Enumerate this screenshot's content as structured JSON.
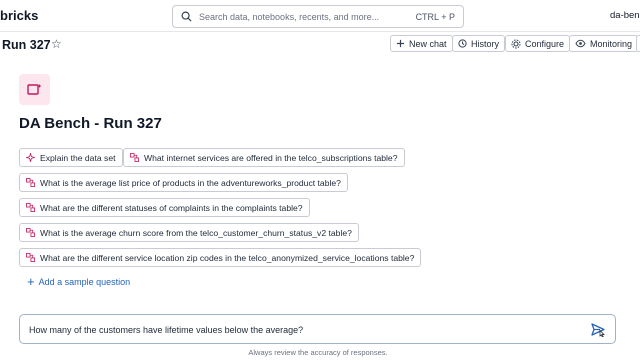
{
  "brand": "bricks",
  "search": {
    "placeholder": "Search data, notebooks, recents, and more...",
    "shortcut": "CTRL + P"
  },
  "workspace": "da-benc",
  "page": {
    "title": "Run 327"
  },
  "toolbar": {
    "new_chat": "New chat",
    "history": "History",
    "configure": "Configure",
    "monitoring": "Monitoring"
  },
  "space": {
    "title": "DA Bench - Run 327"
  },
  "suggestions": [
    "Explain the data set",
    "What internet services are offered in the telco_subscriptions table?",
    "What is the average list price of products in the adventureworks_product table?",
    "What are the different statuses of complaints in the complaints table?",
    "What is the average churn score from the telco_customer_churn_status_v2 table?",
    "What are the different service location zip codes in the telco_anonymized_service_locations table?"
  ],
  "add_sample_label": "Add a sample question",
  "chat_input": {
    "value": "How many of the customers have lifetime values below the average?"
  },
  "disclaimer": "Always review the accuracy of responses.",
  "colors": {
    "accent": "#2564b8",
    "logo_bg": "#fde6ee",
    "logo_icon": "#c2185b"
  }
}
